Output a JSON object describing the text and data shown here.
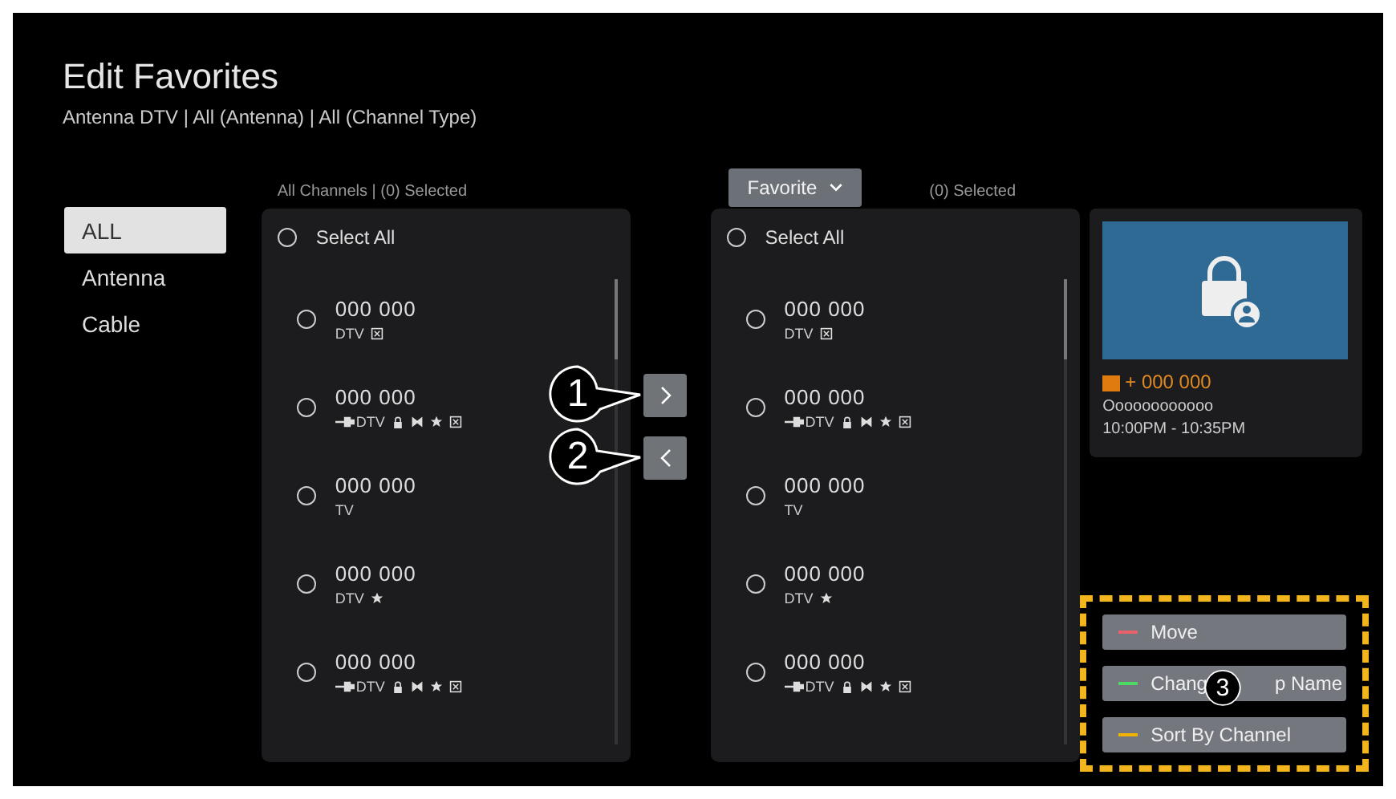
{
  "title": "Edit Favorites",
  "subtitle": "Antenna DTV | All (Antenna) | All (Channel Type)",
  "sidebar": {
    "items": [
      {
        "label": "ALL",
        "selected": true
      },
      {
        "label": "Antenna",
        "selected": false
      },
      {
        "label": "Cable",
        "selected": false
      }
    ]
  },
  "left_panel": {
    "header": "All Channels | (0) Selected",
    "select_all": {
      "label": "Select All",
      "checked": false
    },
    "channels": [
      {
        "number": "000 000",
        "type": "DTV",
        "checked": false,
        "linked": false,
        "locked": false,
        "skipped": false,
        "favorite": false,
        "scrambled": true
      },
      {
        "number": "000 000",
        "type": "DTV",
        "checked": false,
        "linked": true,
        "locked": true,
        "skipped": true,
        "favorite": true,
        "scrambled": true
      },
      {
        "number": "000 000",
        "type": "TV",
        "checked": false,
        "linked": false,
        "locked": false,
        "skipped": false,
        "favorite": false,
        "scrambled": false
      },
      {
        "number": "000 000",
        "type": "DTV",
        "checked": false,
        "linked": false,
        "locked": false,
        "skipped": false,
        "favorite": true,
        "scrambled": false
      },
      {
        "number": "000 000",
        "type": "DTV",
        "checked": false,
        "linked": true,
        "locked": true,
        "skipped": true,
        "favorite": true,
        "scrambled": true
      }
    ]
  },
  "transfer_buttons": [
    {
      "kind": "right",
      "callout": "1"
    },
    {
      "kind": "left",
      "callout": "2"
    }
  ],
  "right_panel": {
    "dropdown": "Favorite",
    "header": "(0) Selected",
    "select_all": {
      "label": "Select All",
      "checked": false
    },
    "channels": [
      {
        "number": "000 000",
        "type": "DTV",
        "checked": false,
        "linked": false,
        "locked": false,
        "skipped": false,
        "favorite": false,
        "scrambled": true
      },
      {
        "number": "000 000",
        "type": "DTV",
        "checked": false,
        "linked": true,
        "locked": true,
        "skipped": true,
        "favorite": true,
        "scrambled": true
      },
      {
        "number": "000 000",
        "type": "TV",
        "checked": false,
        "linked": false,
        "locked": false,
        "skipped": false,
        "favorite": false,
        "scrambled": false
      },
      {
        "number": "000 000",
        "type": "DTV",
        "checked": false,
        "linked": false,
        "locked": false,
        "skipped": false,
        "favorite": true,
        "scrambled": false
      },
      {
        "number": "000 000",
        "type": "DTV",
        "checked": false,
        "linked": true,
        "locked": true,
        "skipped": true,
        "favorite": true,
        "scrambled": true
      }
    ]
  },
  "preview": {
    "channel": "+ 000 000",
    "program": "Oooooooooooo",
    "time": "10:00PM - 10:35PM"
  },
  "actions": {
    "callout": "3",
    "buttons": [
      {
        "parts": [
          "Move"
        ],
        "color": "#e8606a"
      },
      {
        "parts": [
          "Chang",
          "p Name"
        ],
        "color": "#4cd964"
      },
      {
        "parts": [
          "Sort By Channel"
        ],
        "color": "#f0b400"
      }
    ]
  }
}
